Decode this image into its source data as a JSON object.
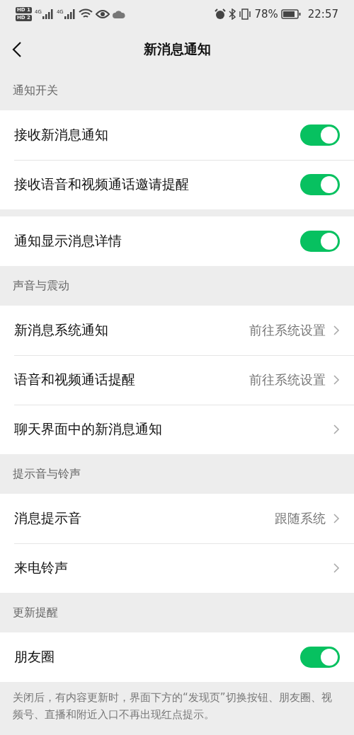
{
  "status_bar": {
    "sim_badges": [
      "HD 1",
      "HD 2"
    ],
    "networks": [
      "4G",
      "4G"
    ],
    "battery": "78%",
    "time": "22:57"
  },
  "nav": {
    "title": "新消息通知"
  },
  "sections": [
    {
      "header": "通知开关",
      "rows": [
        {
          "kind": "toggle",
          "label": "接收新消息通知",
          "on": true
        },
        {
          "kind": "toggle",
          "label": "接收语音和视频通话邀请提醒",
          "on": true
        }
      ]
    },
    {
      "rows": [
        {
          "kind": "toggle",
          "label": "通知显示消息详情",
          "on": true
        }
      ]
    },
    {
      "header": "声音与震动",
      "rows": [
        {
          "kind": "link",
          "label": "新消息系统通知",
          "value": "前往系统设置"
        },
        {
          "kind": "link",
          "label": "语音和视频通话提醒",
          "value": "前往系统设置"
        },
        {
          "kind": "link",
          "label": "聊天界面中的新消息通知"
        }
      ]
    },
    {
      "header": "提示音与铃声",
      "rows": [
        {
          "kind": "link",
          "label": "消息提示音",
          "value": "跟随系统"
        },
        {
          "kind": "link",
          "label": "来电铃声"
        }
      ]
    },
    {
      "header": "更新提醒",
      "rows": [
        {
          "kind": "toggle",
          "label": "朋友圈",
          "on": true
        }
      ],
      "note": "关闭后，有内容更新时，界面下方的“发现页”切换按钮、朋友圈、视频号、直播和附近入口不再出现红点提示。"
    }
  ]
}
